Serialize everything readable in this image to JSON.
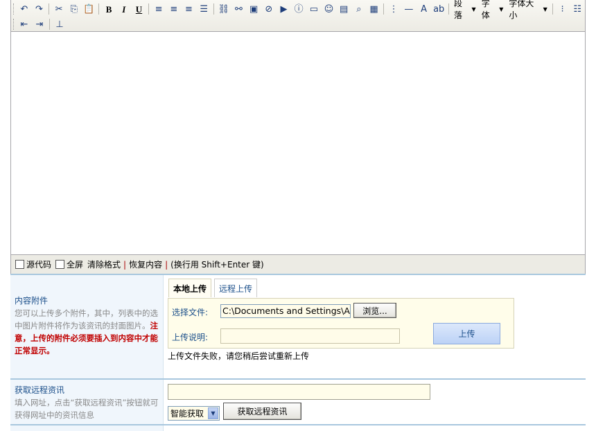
{
  "toolbar": {
    "row1": [
      {
        "icon": "undo-icon",
        "glyph": "↶"
      },
      {
        "icon": "redo-icon",
        "glyph": "↷"
      },
      {
        "sep": true
      },
      {
        "icon": "cut-icon",
        "glyph": "✂"
      },
      {
        "icon": "copy-icon",
        "glyph": "⎘"
      },
      {
        "icon": "paste-icon",
        "glyph": "📋"
      },
      {
        "sep": true
      },
      {
        "icon": "bold-icon",
        "glyph": "B",
        "style": "bold"
      },
      {
        "icon": "italic-icon",
        "glyph": "I",
        "style": "ital"
      },
      {
        "icon": "underline-icon",
        "glyph": "U",
        "style": "undl"
      },
      {
        "sep": true
      },
      {
        "icon": "align-left-icon",
        "glyph": "≡"
      },
      {
        "icon": "align-center-icon",
        "glyph": "≡"
      },
      {
        "icon": "align-right-icon",
        "glyph": "≡"
      },
      {
        "icon": "align-justify-icon",
        "glyph": "☰"
      },
      {
        "sep": true
      },
      {
        "icon": "link-icon",
        "glyph": "⛓"
      },
      {
        "icon": "unlink-icon",
        "glyph": "⚯"
      },
      {
        "icon": "image-icon",
        "glyph": "▣"
      },
      {
        "icon": "flash-icon",
        "glyph": "⊘"
      },
      {
        "icon": "media-icon",
        "glyph": "▶"
      },
      {
        "icon": "info-icon",
        "glyph": "ⓘ"
      },
      {
        "icon": "table-icon",
        "glyph": "▭"
      },
      {
        "icon": "emoticon-icon",
        "glyph": "☺"
      },
      {
        "icon": "page-icon",
        "glyph": "▤"
      },
      {
        "icon": "find-icon",
        "glyph": "⌕"
      },
      {
        "icon": "preview-icon",
        "glyph": "▦"
      },
      {
        "sep": true
      },
      {
        "icon": "insert-row-icon",
        "glyph": "⋮"
      },
      {
        "icon": "horizontal-rule-icon",
        "glyph": "—"
      },
      {
        "icon": "font-color-icon",
        "glyph": "A"
      },
      {
        "icon": "highlight-icon",
        "glyph": "ab"
      },
      {
        "sep": true
      },
      {
        "drop": "段落",
        "name": "paragraph-dropdown"
      },
      {
        "drop": "字体",
        "name": "font-dropdown"
      },
      {
        "drop": "字体大小",
        "name": "font-size-dropdown"
      },
      {
        "sep": true
      },
      {
        "icon": "ordered-list-icon",
        "glyph": "⁝"
      },
      {
        "icon": "unordered-list-icon",
        "glyph": "☷"
      }
    ],
    "row2": [
      {
        "icon": "outdent-icon",
        "glyph": "⇤"
      },
      {
        "icon": "indent-icon",
        "glyph": "⇥"
      },
      {
        "sep": true
      },
      {
        "icon": "clear-style-icon",
        "glyph": "⊥"
      }
    ]
  },
  "footer": {
    "source_label": "源代码",
    "fullscreen_label": "全屏",
    "clear_format_label": "清除格式",
    "restore_label": "恢复内容",
    "hint": "(换行用 Shift+Enter 键)"
  },
  "attachments": {
    "title": "内容附件",
    "desc_before": "您可以上传多个附件，其中，列表中的选中图片附件将作为该资讯的封面图片。",
    "desc_warn": "注意，上传的附件必须要插入到内容中才能正常显示。",
    "tabs": [
      "本地上传",
      "远程上传"
    ],
    "file_label": "选择文件:",
    "file_value": "C:\\Documents and Settings\\Administrator",
    "browse_label": "浏览...",
    "desc_label": "上传说明:",
    "upload_label": "上传",
    "fail_message": "上传文件失败，请您稍后尝试重新上传"
  },
  "remote": {
    "title": "获取远程资讯",
    "desc": "填入网址，点击“获取远程资讯”按钮就可获得网址中的资讯信息",
    "select_value": "智能获取",
    "fetch_label": "获取远程资讯"
  }
}
